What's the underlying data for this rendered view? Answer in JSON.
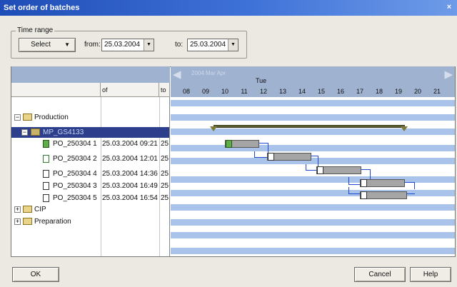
{
  "window": {
    "title": "Set order of batches",
    "close_glyph": "×"
  },
  "time_range": {
    "group_label": "Time range",
    "select_label": "Select",
    "from_label": "from:",
    "from_value": "25.03.2004",
    "to_label": "to:",
    "to_value": "25.03.2004"
  },
  "grid": {
    "columns": {
      "name": "",
      "of": "of",
      "to": "to"
    },
    "rows": [
      {
        "name": "Production",
        "of": "",
        "to": ""
      },
      {
        "name": "MP_GS4133",
        "of": "",
        "to": ""
      },
      {
        "name": "PO_250304 1",
        "of": "25.03.2004 09:21",
        "to": "25"
      },
      {
        "name": "PO_250304 2",
        "of": "25.03.2004 12:01",
        "to": "25"
      },
      {
        "name": "PO_250304 4",
        "of": "25.03.2004 14:36",
        "to": "25"
      },
      {
        "name": "PO_250304 3",
        "of": "25.03.2004 16:49",
        "to": "25"
      },
      {
        "name": "PO_250304 5",
        "of": "25.03.2004 16:54",
        "to": "25"
      },
      {
        "name": "CIP",
        "of": "",
        "to": ""
      },
      {
        "name": "Preparation",
        "of": "",
        "to": ""
      }
    ]
  },
  "timeline": {
    "banner": "2004 Mar Apr",
    "day": "Tue",
    "hours": [
      "08",
      "09",
      "10",
      "11",
      "12",
      "13",
      "14",
      "15",
      "16",
      "17",
      "18",
      "19",
      "20",
      "21"
    ]
  },
  "buttons": {
    "ok": "OK",
    "cancel": "Cancel",
    "help": "Help"
  },
  "colors": {
    "title_bar": "#1f4db7",
    "selected_row": "#2d3f8c",
    "stripe": "#a9c3ea",
    "link": "#2147d0"
  }
}
